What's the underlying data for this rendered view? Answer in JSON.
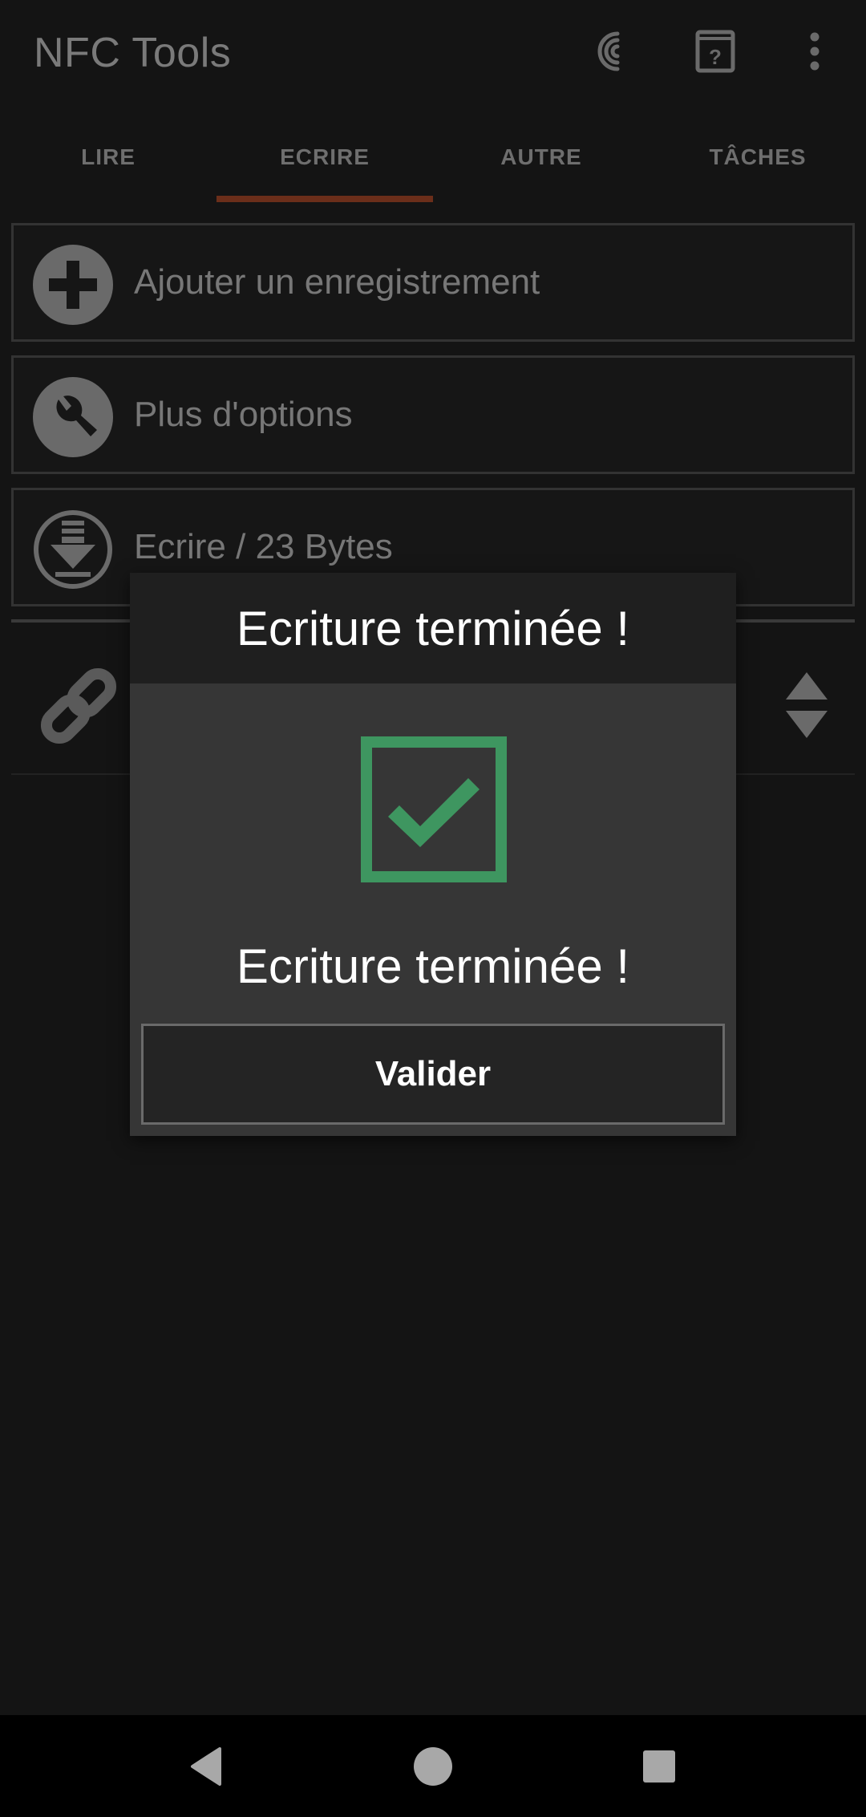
{
  "toolbar": {
    "title": "NFC Tools",
    "icons": [
      "nfc-scan-icon",
      "help-book-icon",
      "overflow-menu-icon"
    ]
  },
  "tabs": [
    {
      "label": "LIRE"
    },
    {
      "label": "ECRIRE",
      "selected": true
    },
    {
      "label": "AUTRE"
    },
    {
      "label": "TÂCHES"
    }
  ],
  "actions": {
    "add_record": {
      "label": "Ajouter un enregistrement",
      "icon": "plus-circle-icon"
    },
    "more_options": {
      "label": "Plus d'options",
      "icon": "wrench-icon"
    },
    "write": {
      "label": "Ecrire / 23 Bytes",
      "icon": "download-circle-icon"
    }
  },
  "record": {
    "icon": "link-icon",
    "reorder_icon": "reorder-arrows-icon"
  },
  "dialog": {
    "title": "Ecriture terminée !",
    "message": "Ecriture terminée !",
    "icon": "check-box-icon",
    "button_label": "Valider"
  },
  "colors": {
    "tab_indicator": "#6b2e1a",
    "check_green": "#3e9660",
    "dialog_body": "#363636",
    "dialog_header": "#1f1f1f"
  },
  "navbar": {
    "icons": [
      "back-icon",
      "home-icon",
      "recents-icon"
    ]
  }
}
